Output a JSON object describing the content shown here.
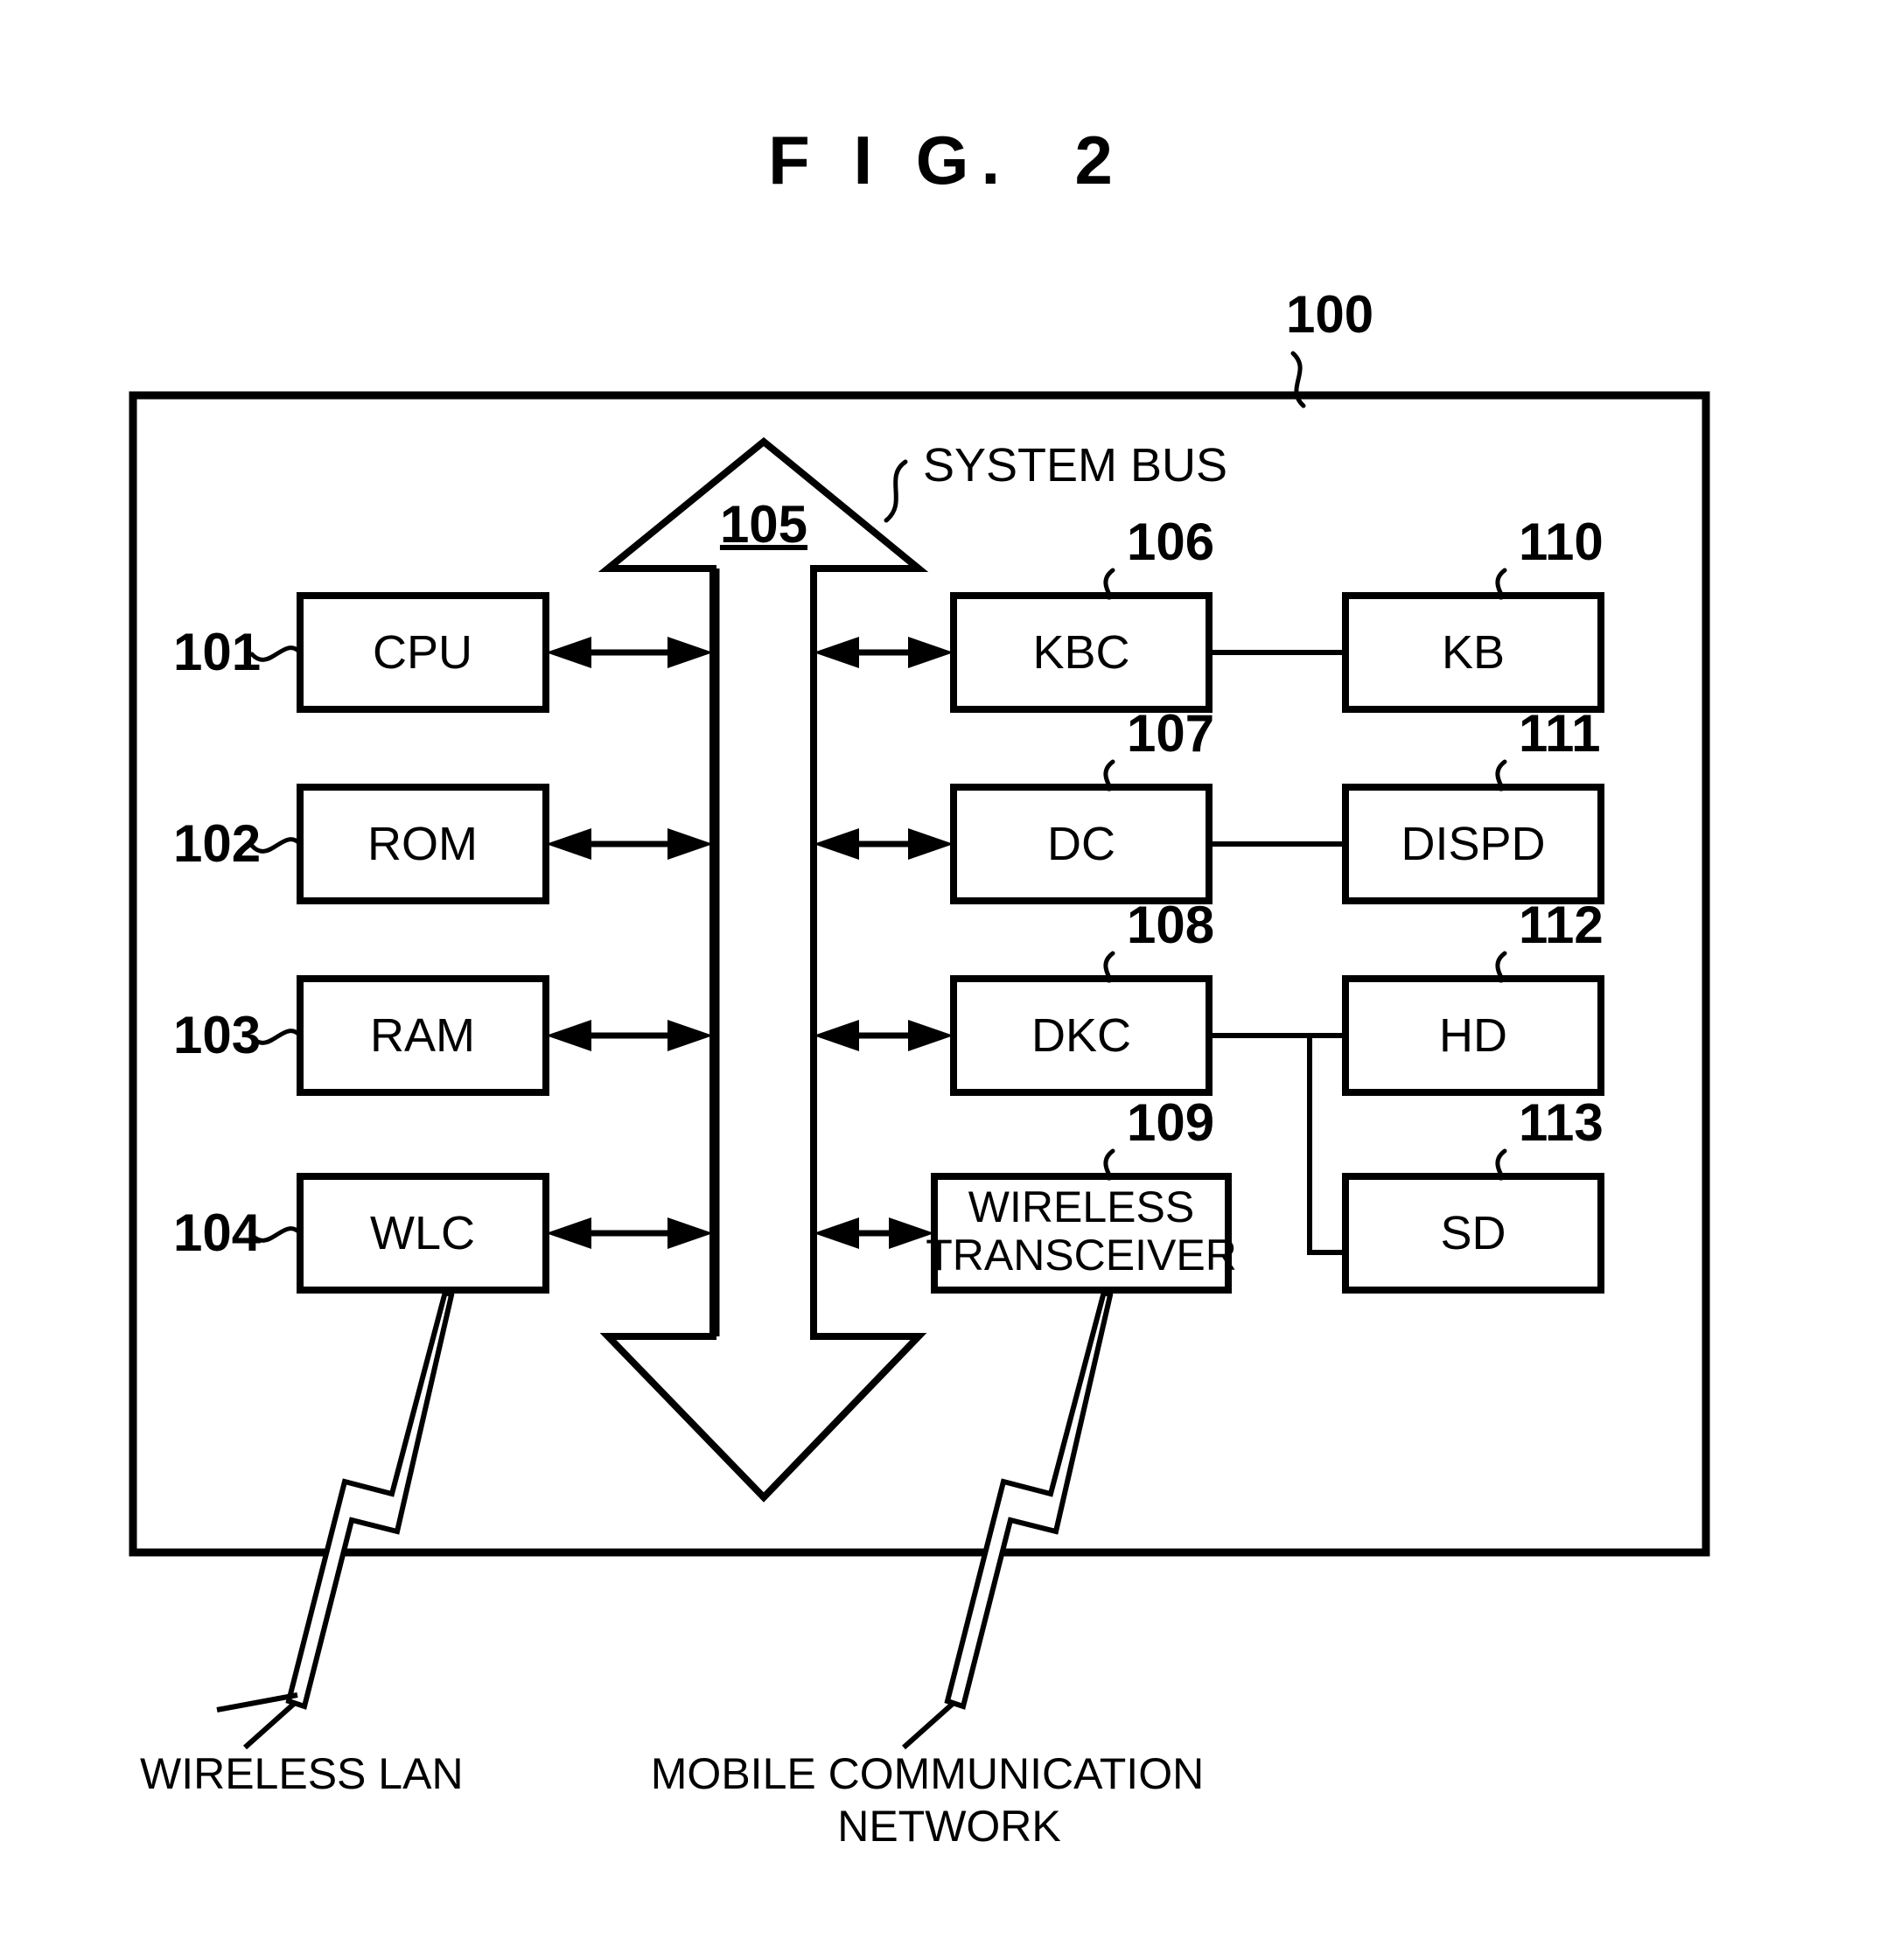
{
  "figure": {
    "title": "F I G.  2",
    "device_ref": "100",
    "bus": {
      "ref": "105",
      "label": "SYSTEM BUS"
    }
  },
  "left_column": [
    {
      "ref": "101",
      "label": "CPU"
    },
    {
      "ref": "102",
      "label": "ROM"
    },
    {
      "ref": "103",
      "label": "RAM"
    },
    {
      "ref": "104",
      "label": "WLC"
    }
  ],
  "middle_column": [
    {
      "ref": "106",
      "label": "KBC"
    },
    {
      "ref": "107",
      "label": "DC"
    },
    {
      "ref": "108",
      "label": "DKC"
    },
    {
      "ref": "109",
      "label_line1": "WIRELESS",
      "label_line2": "TRANSCEIVER"
    }
  ],
  "right_column": [
    {
      "ref": "110",
      "label": "KB"
    },
    {
      "ref": "111",
      "label": "DISPD"
    },
    {
      "ref": "112",
      "label": "HD"
    },
    {
      "ref": "113",
      "label": "SD"
    }
  ],
  "network_labels": {
    "wireless_lan": "WIRELESS LAN",
    "mobile_network_line1": "MOBILE COMMUNICATION",
    "mobile_network_line2": "NETWORK"
  },
  "colors": {
    "ink": "#000000",
    "paper": "#ffffff"
  }
}
